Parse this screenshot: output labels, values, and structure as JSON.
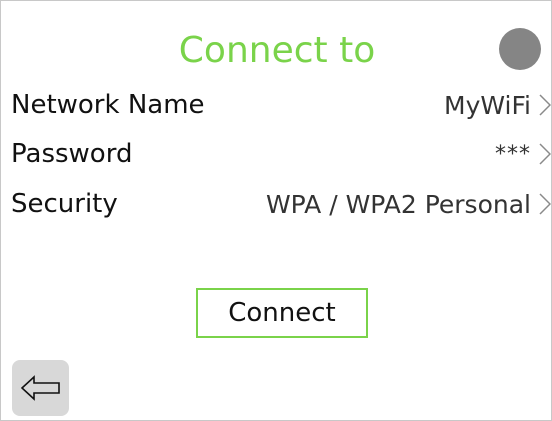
{
  "header": {
    "title": "Connect to",
    "status_color": "#858585",
    "accent_color": "#7ad34a"
  },
  "fields": [
    {
      "label": "Network Name",
      "value": "MyWiFi"
    },
    {
      "label": "Password",
      "value": "***"
    },
    {
      "label": "Security",
      "value": "WPA / WPA2 Personal"
    }
  ],
  "actions": {
    "connect_label": "Connect",
    "back_icon": "back-arrow-icon"
  }
}
